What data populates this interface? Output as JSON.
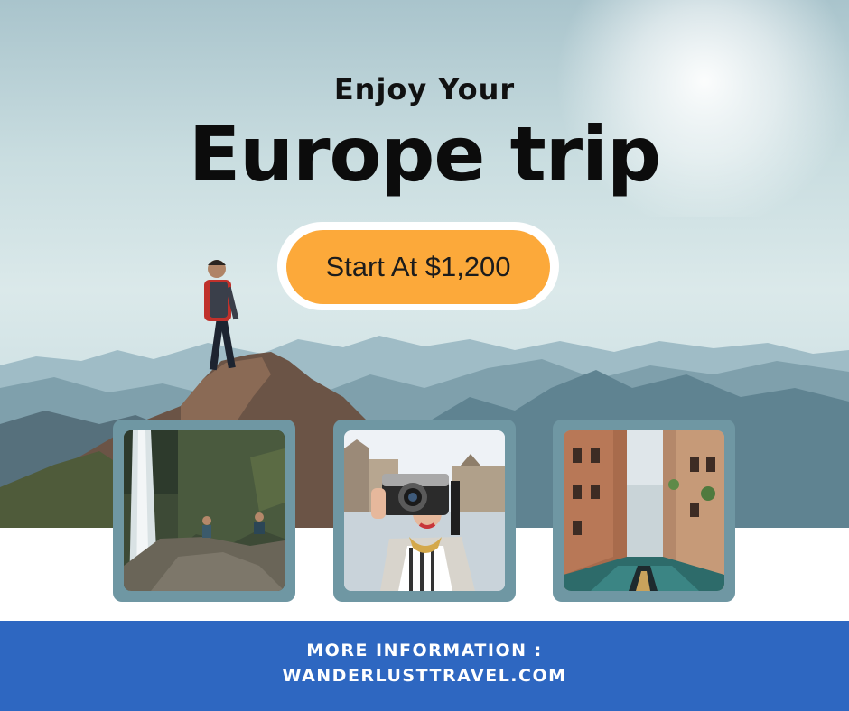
{
  "headline": {
    "small": "Enjoy Your",
    "big": "Europe trip"
  },
  "cta": {
    "label": "Start At $1,200"
  },
  "photos": [
    {
      "icon": "waterfall-photo"
    },
    {
      "icon": "camera-tourist-photo"
    },
    {
      "icon": "canal-photo"
    }
  ],
  "footer": {
    "info_label": "MORE INFORMATION :",
    "website": "WANDERLUSTTRAVEL.COM"
  },
  "colors": {
    "cta": "#fca93a",
    "footer": "#2e67c1",
    "frame": "#6f97a3"
  }
}
